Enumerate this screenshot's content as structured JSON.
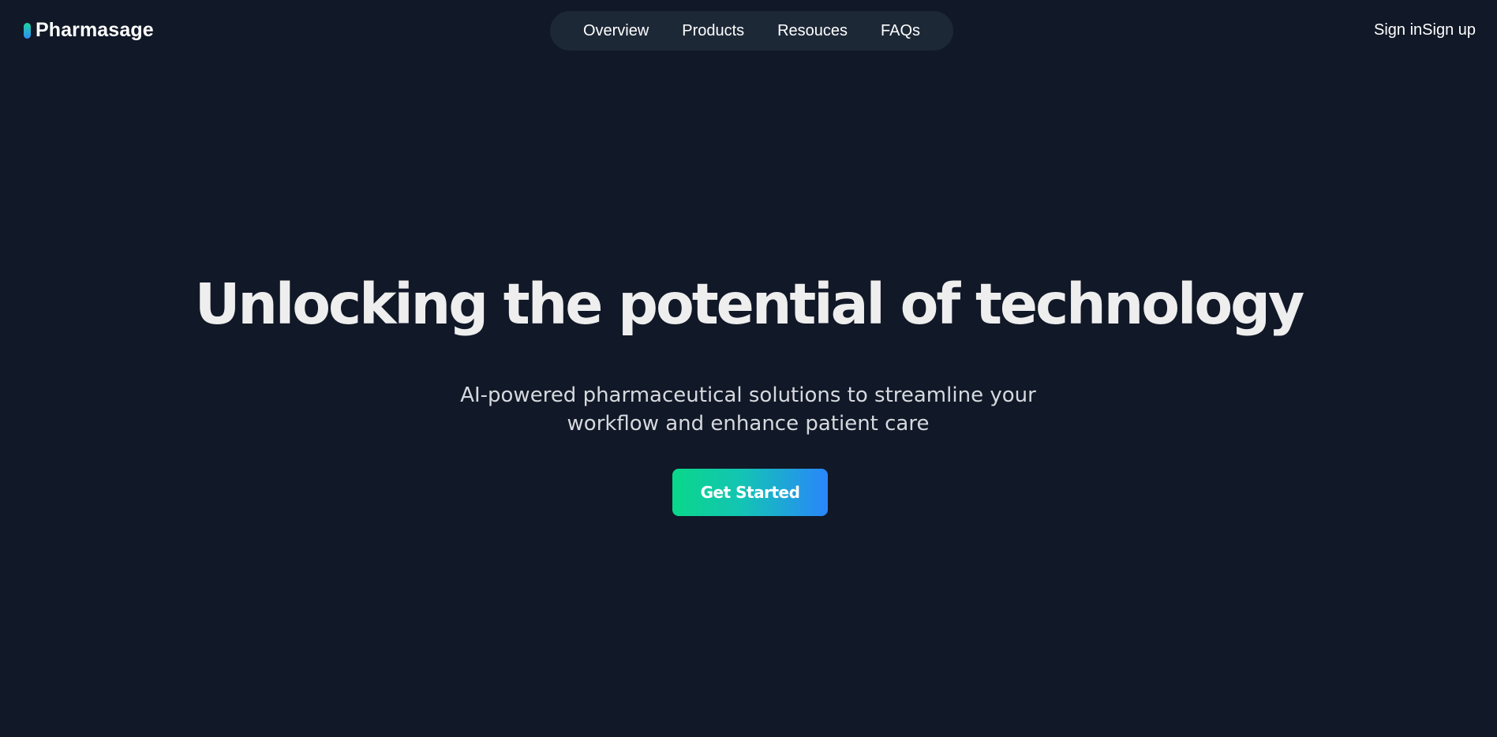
{
  "header": {
    "brand": "Pharmasage",
    "nav": [
      {
        "label": "Overview"
      },
      {
        "label": "Products"
      },
      {
        "label": "Resouces"
      },
      {
        "label": "FAQs"
      }
    ],
    "sign_in": "Sign in",
    "sign_up": "Sign up"
  },
  "hero": {
    "title": "Unlocking the potential of technology",
    "subtitle": "AI-powered pharmaceutical solutions to streamline your workflow and enhance patient care",
    "cta_label": "Get Started"
  },
  "colors": {
    "background": "#111827",
    "nav_pill": "#1d2837",
    "accent_start": "#0ad78a",
    "accent_end": "#2a86fb"
  }
}
